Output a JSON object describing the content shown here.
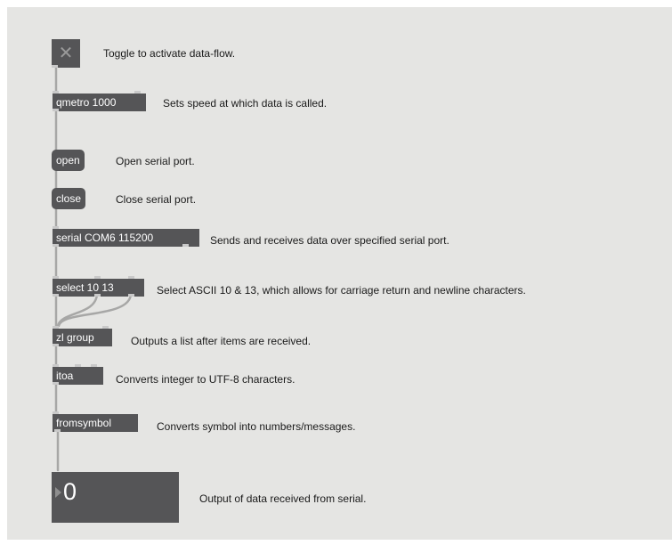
{
  "objects": {
    "toggle": {
      "symbol": "✕",
      "comment": "Toggle to activate data-flow."
    },
    "qmetro": {
      "label": "qmetro 1000",
      "comment": "Sets speed at which data is called."
    },
    "open_msg": {
      "label": "open",
      "comment": "Open serial port."
    },
    "close_msg": {
      "label": "close",
      "comment": "Close serial port."
    },
    "serial": {
      "label": "serial COM6 115200",
      "comment": "Sends and receives data over specified serial port."
    },
    "select": {
      "label": "select 10 13",
      "comment": "Select ASCII 10 & 13, which allows for carriage return and newline characters."
    },
    "zl_group": {
      "label": "zl group",
      "comment": "Outputs a list after items are received."
    },
    "itoa": {
      "label": "itoa",
      "comment": "Converts integer to UTF-8 characters."
    },
    "fromsymbol": {
      "label": "fromsymbol",
      "comment": "Converts symbol into numbers/messages."
    },
    "number": {
      "value": "0",
      "comment": "Output of data received from serial."
    }
  },
  "colors": {
    "canvas": "#e5e5e3",
    "box": "#555557",
    "patchcord": "#a7a7a6",
    "text": "#1a1a1a"
  }
}
